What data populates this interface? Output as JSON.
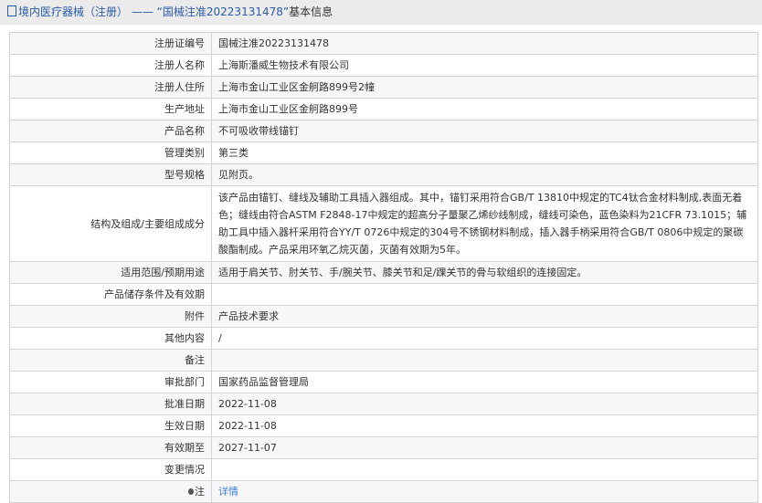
{
  "header": {
    "prefix": "境内医疗器械（注册）",
    "dash": "——",
    "title": "“国械注准20223131478”",
    "suffix": "基本信息"
  },
  "rows": [
    {
      "label": "注册证编号",
      "value": "国械注准20223131478"
    },
    {
      "label": "注册人名称",
      "value": "上海斯潘威生物技术有限公司"
    },
    {
      "label": "注册人住所",
      "value": "上海市金山工业区金舸路899号2幢"
    },
    {
      "label": "生产地址",
      "value": "上海市金山工业区金舸路899号"
    },
    {
      "label": "产品名称",
      "value": "不可吸收带线锚钉"
    },
    {
      "label": "管理类别",
      "value": "第三类"
    },
    {
      "label": "型号规格",
      "value": "见附页。"
    },
    {
      "label": "结构及组成/主要组成成分",
      "value": "该产品由锚钉、缝线及辅助工具插入器组成。其中，锚钉采用符合GB/T 13810中规定的TC4钛合金材料制成,表面无着色；缝线由符合ASTM F2848-17中规定的超高分子量聚乙烯纱线制成，缝线可染色，蓝色染料为21CFR 73.1015；辅助工具中插入器杆采用符合YY/T 0726中规定的304号不锈钢材料制成，插入器手柄采用符合GB/T 0806中规定的聚碳酸酯制成。产品采用环氧乙烷灭菌，灭菌有效期为5年。"
    },
    {
      "label": "适用范围/预期用途",
      "value": "适用于肩关节、肘关节、手/腕关节、膝关节和足/踝关节的骨与软组织的连接固定。"
    },
    {
      "label": "产品储存条件及有效期",
      "value": ""
    },
    {
      "label": "附件",
      "value": "产品技术要求"
    },
    {
      "label": "其他内容",
      "value": "/"
    },
    {
      "label": "备注",
      "value": ""
    },
    {
      "label": "审批部门",
      "value": "国家药品监督管理局"
    },
    {
      "label": "批准日期",
      "value": "2022-11-08"
    },
    {
      "label": "生效日期",
      "value": "2022-11-08"
    },
    {
      "label": "有效期至",
      "value": "2027-11-07"
    },
    {
      "label": "变更情况",
      "value": ""
    }
  ],
  "note": {
    "label": "注",
    "link": "详情"
  }
}
